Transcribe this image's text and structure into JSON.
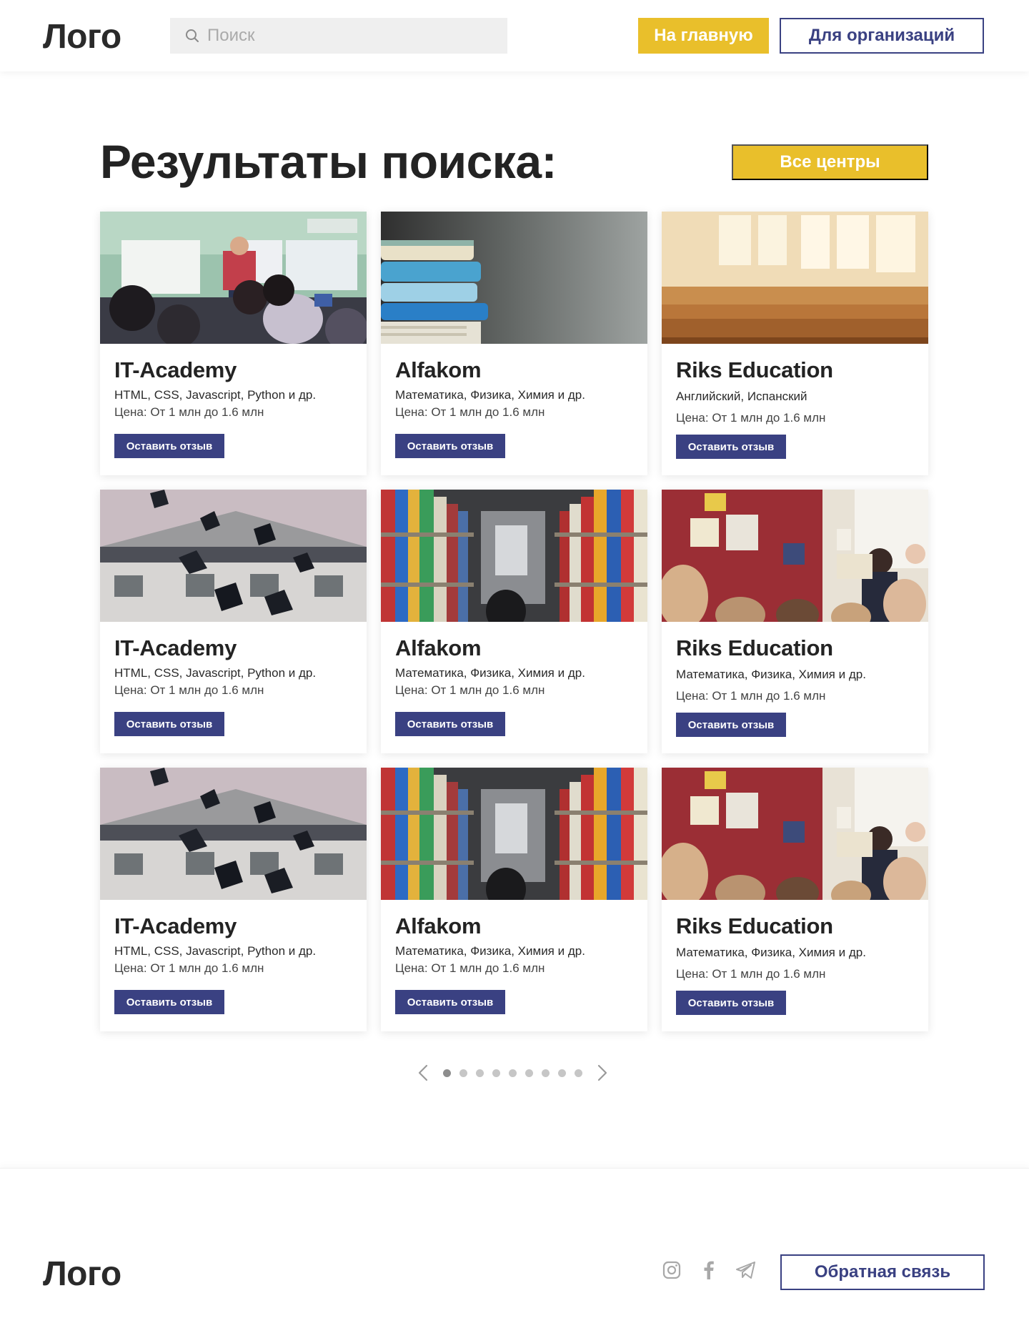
{
  "header": {
    "logo": "Лого",
    "search_placeholder": "Поиск",
    "home_button": "На главную",
    "org_button": "Для организаций"
  },
  "main": {
    "title": "Результаты поиска:",
    "all_centers_button": "Все центры"
  },
  "cards": [
    {
      "title": "IT-Academy",
      "subjects": "HTML, CSS, Javascript, Python и др.",
      "price": "Цена: От 1 млн до 1.6 млн",
      "review_label": "Оставить отзыв",
      "image": "classroom-teacher-photo"
    },
    {
      "title": "Alfakom",
      "subjects": "Математика, Физика, Химия и др.",
      "price": "Цена: От 1 млн до 1.6 млн",
      "review_label": "Оставить отзыв",
      "image": "stacked-books-photo"
    },
    {
      "title": "Riks Education",
      "subjects": "Английский, Испанский",
      "price": "Цена: От 1 млн до 1.6 млн",
      "review_label": "Оставить отзыв",
      "image": "empty-classroom-photo"
    },
    {
      "title": "IT-Academy",
      "subjects": "HTML, CSS, Javascript, Python и др.",
      "price": "Цена: От 1 млн до 1.6 млн",
      "review_label": "Оставить отзыв",
      "image": "graduation-caps-photo"
    },
    {
      "title": "Alfakom",
      "subjects": "Математика, Физика, Химия и др.",
      "price": "Цена: От 1 млн до 1.6 млн",
      "review_label": "Оставить отзыв",
      "image": "library-shelves-photo"
    },
    {
      "title": "Riks Education",
      "subjects": "Математика, Физика, Химия и др.",
      "price": "Цена: От 1 млн до 1.6 млн",
      "review_label": "Оставить отзыв",
      "image": "kids-classroom-photo"
    },
    {
      "title": "IT-Academy",
      "subjects": "HTML, CSS, Javascript, Python и др.",
      "price": "Цена: От 1 млн до 1.6 млн",
      "review_label": "Оставить отзыв",
      "image": "graduation-caps-photo"
    },
    {
      "title": "Alfakom",
      "subjects": "Математика, Физика, Химия и др.",
      "price": "Цена: От 1 млн до 1.6 млн",
      "review_label": "Оставить отзыв",
      "image": "library-shelves-photo"
    },
    {
      "title": "Riks Education",
      "subjects": "Математика, Физика, Химия и др.",
      "price": "Цена: От 1 млн до 1.6 млн",
      "review_label": "Оставить отзыв",
      "image": "kids-classroom-photo"
    }
  ],
  "pagination": {
    "pages": 9,
    "current": 1,
    "prev_icon": "chevron-left-icon",
    "next_icon": "chevron-right-icon"
  },
  "footer": {
    "logo": "Лого",
    "socials": [
      "instagram-icon",
      "facebook-icon",
      "telegram-icon"
    ],
    "feedback_button": "Обратная связь"
  },
  "colors": {
    "accent_yellow": "#e9bf2b",
    "brand_navy": "#3a4182",
    "search_bg": "#efefef"
  }
}
